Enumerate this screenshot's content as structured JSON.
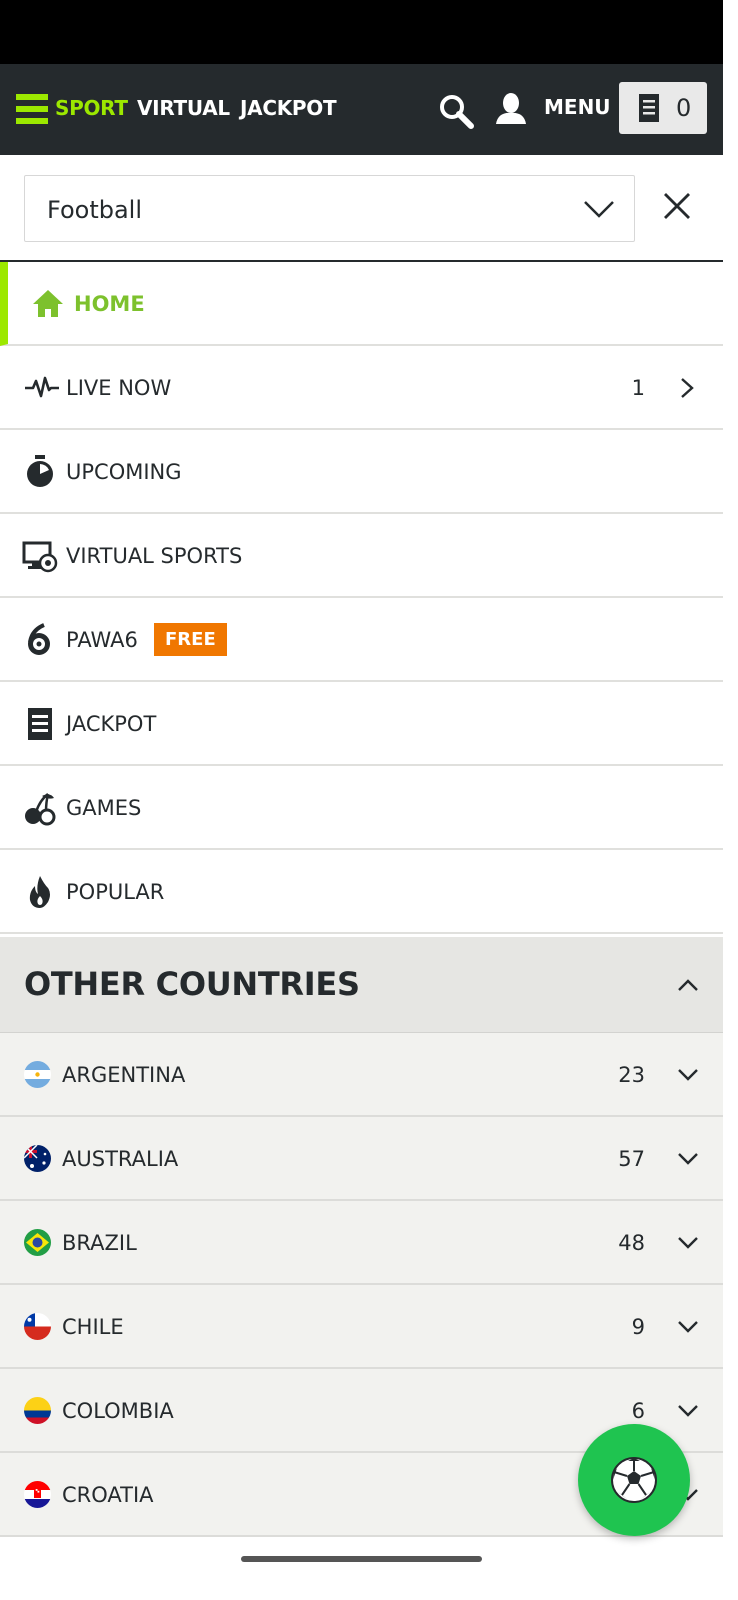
{
  "header": {
    "nav": [
      {
        "label": "SPORT",
        "active": true
      },
      {
        "label": "VIRTUAL",
        "active": false
      },
      {
        "label": "JACKPOT",
        "active": false
      }
    ],
    "menu_label": "MENU",
    "betslip_count": "0"
  },
  "filter": {
    "sport_selected": "Football"
  },
  "menu": {
    "items": [
      {
        "label": "HOME",
        "icon": "home-icon"
      },
      {
        "label": "LIVE NOW",
        "icon": "pulse-icon",
        "count": "1"
      },
      {
        "label": "UPCOMING",
        "icon": "stopwatch-icon"
      },
      {
        "label": "VIRTUAL SPORTS",
        "icon": "monitor-ball-icon"
      },
      {
        "label": "PAWA6",
        "icon": "pawa6-icon",
        "badge": "FREE"
      },
      {
        "label": "JACKPOT",
        "icon": "jackpot-icon"
      },
      {
        "label": "GAMES",
        "icon": "cherries-icon"
      },
      {
        "label": "POPULAR",
        "icon": "flame-icon"
      }
    ]
  },
  "countries": {
    "title": "OTHER COUNTRIES",
    "rows": [
      {
        "name": "ARGENTINA",
        "count": "23"
      },
      {
        "name": "AUSTRALIA",
        "count": "57"
      },
      {
        "name": "BRAZIL",
        "count": "48"
      },
      {
        "name": "CHILE",
        "count": "9"
      },
      {
        "name": "COLOMBIA",
        "count": "6"
      },
      {
        "name": "CROATIA",
        "count": ""
      }
    ]
  },
  "colors": {
    "accent_green": "#9ce800",
    "header_bg": "#252a2d",
    "badge_orange": "#f07700",
    "fab_green": "#1fc450"
  }
}
